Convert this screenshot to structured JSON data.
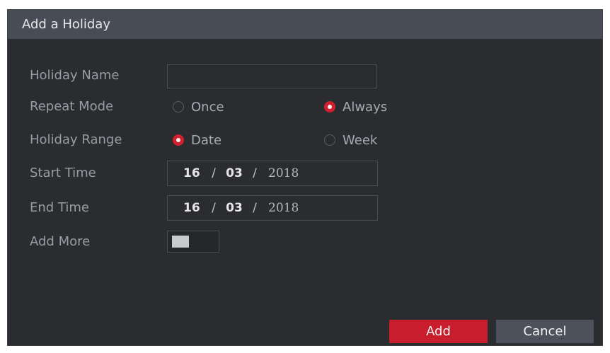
{
  "dialog": {
    "title": "Add a Holiday"
  },
  "form": {
    "holiday_name": {
      "label": "Holiday Name",
      "value": ""
    },
    "repeat_mode": {
      "label": "Repeat Mode",
      "options": [
        {
          "label": "Once",
          "checked": false
        },
        {
          "label": "Always",
          "checked": true
        }
      ]
    },
    "holiday_range": {
      "label": "Holiday Range",
      "options": [
        {
          "label": "Date",
          "checked": true
        },
        {
          "label": "Week",
          "checked": false
        }
      ]
    },
    "start_time": {
      "label": "Start Time",
      "day": "16",
      "sep1": "/",
      "month": "03",
      "sep2": "/",
      "year": "2018"
    },
    "end_time": {
      "label": "End Time",
      "day": "16",
      "sep1": "/",
      "month": "03",
      "sep2": "/",
      "year": "2018"
    },
    "add_more": {
      "label": "Add More",
      "enabled": false
    }
  },
  "buttons": {
    "add": "Add",
    "cancel": "Cancel"
  },
  "colors": {
    "accent": "#c81d2c",
    "background": "#2b2c30",
    "titlebar": "#484c56"
  }
}
